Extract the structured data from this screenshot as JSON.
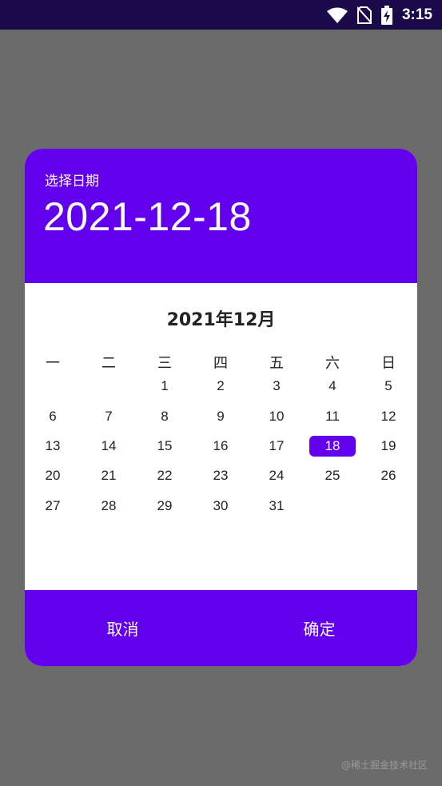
{
  "status_bar": {
    "time": "3:15",
    "icons": [
      "wifi-icon",
      "no-sim-icon",
      "battery-charging-icon"
    ]
  },
  "dialog": {
    "header_label": "选择日期",
    "selected_date": "2021-12-18",
    "month_title": "2021年12月",
    "weekdays": [
      "一",
      "二",
      "三",
      "四",
      "五",
      "六",
      "日"
    ],
    "weeks": [
      [
        "",
        "",
        "1",
        "2",
        "3",
        "4",
        "5"
      ],
      [
        "6",
        "7",
        "8",
        "9",
        "10",
        "11",
        "12"
      ],
      [
        "13",
        "14",
        "15",
        "16",
        "17",
        "18",
        "19"
      ],
      [
        "20",
        "21",
        "22",
        "23",
        "24",
        "25",
        "26"
      ],
      [
        "27",
        "28",
        "29",
        "30",
        "31",
        "",
        ""
      ]
    ],
    "selected_day": "18",
    "cancel_label": "取消",
    "confirm_label": "确定"
  },
  "watermark": "@稀土掘金技术社区",
  "colors": {
    "accent": "#6200ee",
    "status_bar": "#1a0a4a",
    "scrim": "#6b6b6b"
  }
}
